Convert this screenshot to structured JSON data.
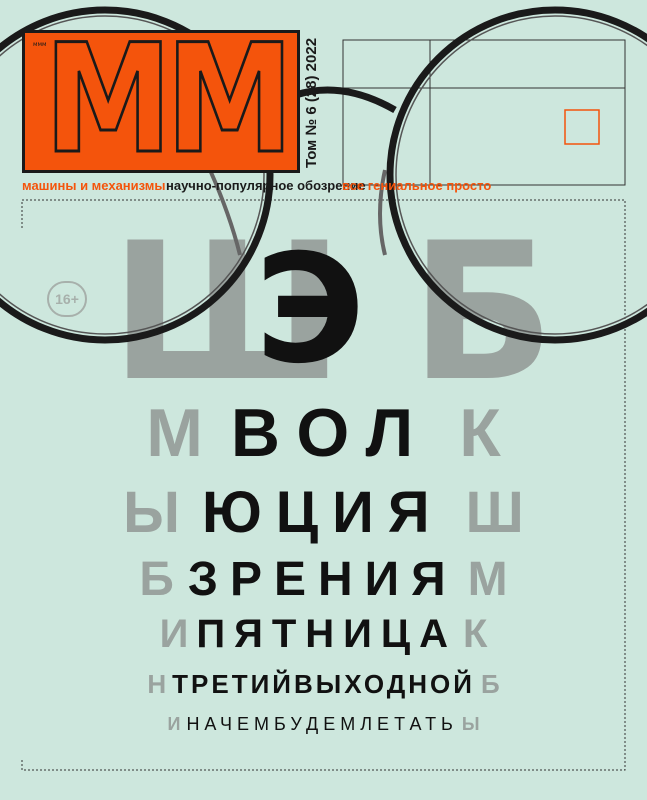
{
  "logo": {
    "text": "MM",
    "small": "ммм"
  },
  "issue_info": "Том № 6 (28) 2022",
  "taglines": {
    "left": "машины и механизмы",
    "center": "научно-популярное обозрение",
    "right": "все гениальное просто"
  },
  "age_rating": "16+",
  "chart_rows": {
    "row1_ghost_left": "Ш",
    "row1_dark": "Э",
    "row1_ghost_right": "Б",
    "row2_left": "М",
    "row2_dark": "ВОЛ",
    "row2_right": "К",
    "row3_left": "Ы",
    "row3_dark": "ЮЦИЯ",
    "row3_right": "Ш",
    "row4_left": "Б",
    "row4_dark": "ЗРЕНИЯ",
    "row4_right": "М",
    "row5_left": "И",
    "row5_dark": "ПЯТНИЦА",
    "row5_right": "К",
    "row6_left": "Н",
    "row6_dark": "ТРЕТИЙВЫХОДНОЙ",
    "row6_right": "Б",
    "row7_left": "И",
    "row7_dark": "НАЧЕМБУДЕМЛЕТАТЬ",
    "row7_right": "Ы"
  },
  "colors": {
    "background": "#cde7dd",
    "accent": "#f4540c",
    "ink": "#111111",
    "ghost": "#9aa39f"
  }
}
